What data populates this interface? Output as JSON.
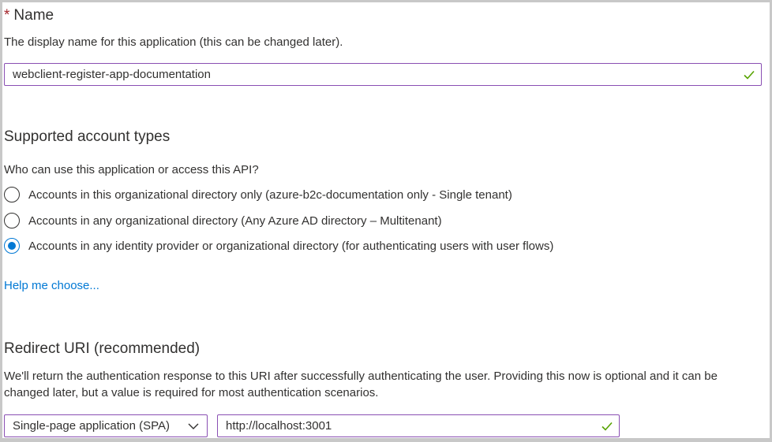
{
  "name_section": {
    "required_marker": "*",
    "title": "Name",
    "description": "The display name for this application (this can be changed later).",
    "input_value": "webclient-register-app-documentation"
  },
  "account_types": {
    "title": "Supported account types",
    "question": "Who can use this application or access this API?",
    "options": [
      {
        "label": "Accounts in this organizational directory only (azure-b2c-documentation only - Single tenant)",
        "selected": false
      },
      {
        "label": "Accounts in any organizational directory (Any Azure AD directory – Multitenant)",
        "selected": false
      },
      {
        "label": "Accounts in any identity provider or organizational directory (for authenticating users with user flows)",
        "selected": true
      }
    ],
    "help_link": "Help me choose..."
  },
  "redirect": {
    "title": "Redirect URI (recommended)",
    "description": "We'll return the authentication response to this URI after successfully authenticating the user. Providing this now is optional and it can be changed later, but a value is required for most authentication scenarios.",
    "platform_selected": "Single-page application (SPA)",
    "uri_value": "http://localhost:3001"
  },
  "colors": {
    "accent": "#0078d4",
    "field_border": "#8a4fb3",
    "valid_check": "#57a300",
    "required": "#a4262c"
  },
  "icons": {
    "valid": "check-icon",
    "dropdown": "chevron-down-icon"
  }
}
